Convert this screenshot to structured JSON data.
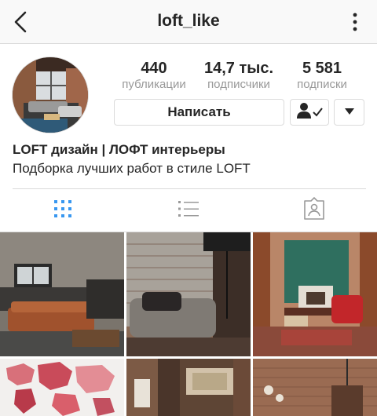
{
  "header": {
    "username": "loft_like"
  },
  "profile": {
    "stats": [
      {
        "value": "440",
        "label": "публикации"
      },
      {
        "value": "14,7 тыс.",
        "label": "подписчики"
      },
      {
        "value": "5 581",
        "label": "подписки"
      }
    ],
    "message_button": "Написать",
    "name": "LOFT дизайн | ЛОФТ интерьеры",
    "bio": "Подборка лучших работ в стиле LOFT"
  },
  "tabs": [
    {
      "icon": "grid-icon",
      "active": true
    },
    {
      "icon": "list-icon",
      "active": false
    },
    {
      "icon": "tagged-icon",
      "active": false
    }
  ],
  "colors": {
    "accent": "#3897f0",
    "text": "#262626",
    "muted": "#999999",
    "border": "#dbdbdb"
  }
}
